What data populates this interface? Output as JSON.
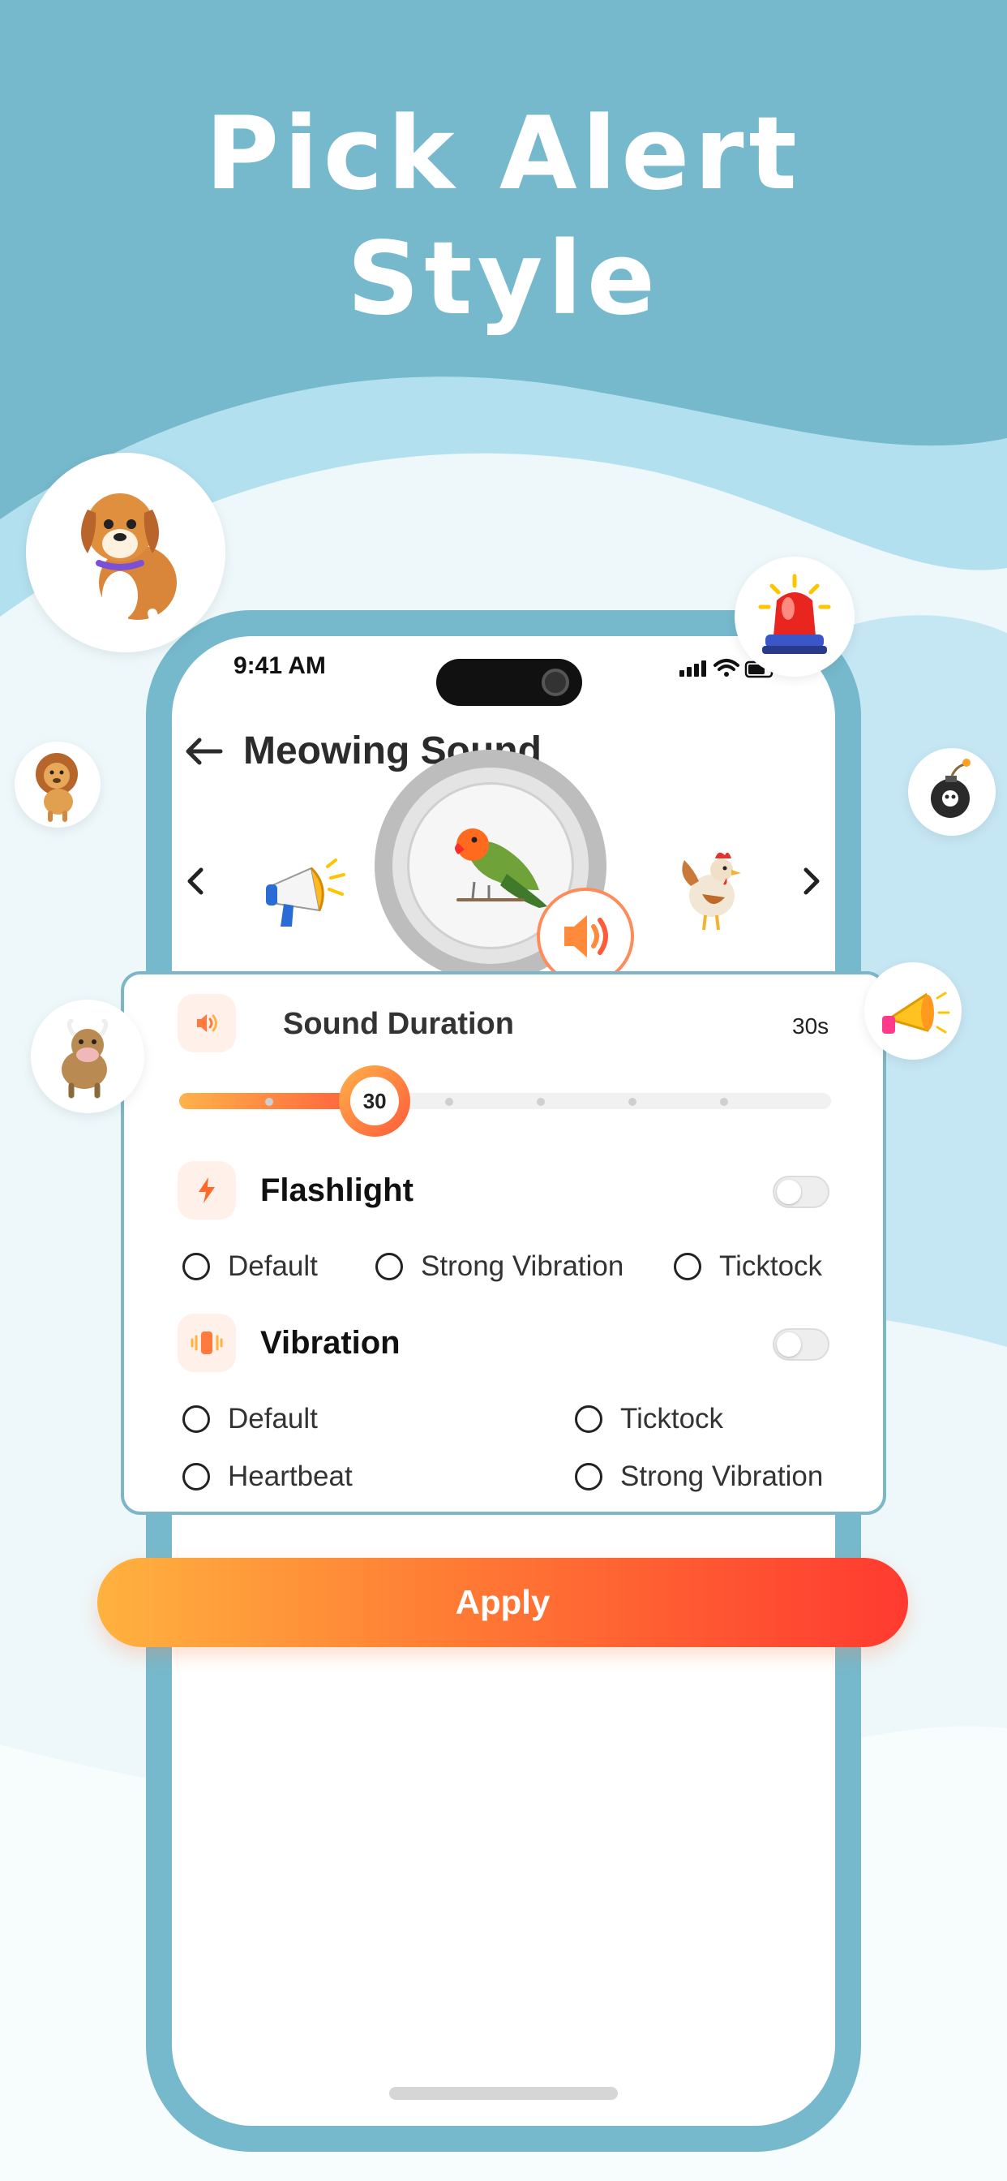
{
  "headline": {
    "line1": "Pick Alert",
    "line2": "Style"
  },
  "colors": {
    "background_top": "#76b9cc",
    "wave_light": "#b3e0ef",
    "wave_lightest": "#eef8fb",
    "phone_frame": "#76b9cc",
    "accent_orange": "#ff7a34",
    "accent_red": "#ff3a30",
    "accent_yellow": "#ffb23f"
  },
  "status_bar": {
    "time": "9:41 AM",
    "icons": [
      "signal-icon",
      "wifi-icon",
      "battery-icon"
    ]
  },
  "app_header": {
    "title": "Meowing Sound",
    "back_icon": "arrow-left-icon"
  },
  "carousel": {
    "items": [
      "megaphone",
      "lovebird",
      "rooster"
    ],
    "selected": "lovebird",
    "prev_icon": "chevron-left-icon",
    "next_icon": "chevron-right-icon",
    "play_icon": "speaker-icon"
  },
  "sound_duration": {
    "label": "Sound Duration",
    "value_text": "30s",
    "slider_value": "30",
    "slider_fraction": 0.3
  },
  "flashlight": {
    "label": "Flashlight",
    "enabled": false,
    "options": [
      "Default",
      "Strong Vibration",
      "Ticktock"
    ]
  },
  "vibration": {
    "label": "Vibration",
    "enabled": false,
    "options": [
      "Default",
      "Ticktock",
      "Heartbeat",
      "Strong Vibration"
    ]
  },
  "apply_button": {
    "label": "Apply"
  },
  "floating_bubbles": [
    "dog",
    "siren",
    "lion",
    "bomb",
    "cow",
    "horn"
  ]
}
